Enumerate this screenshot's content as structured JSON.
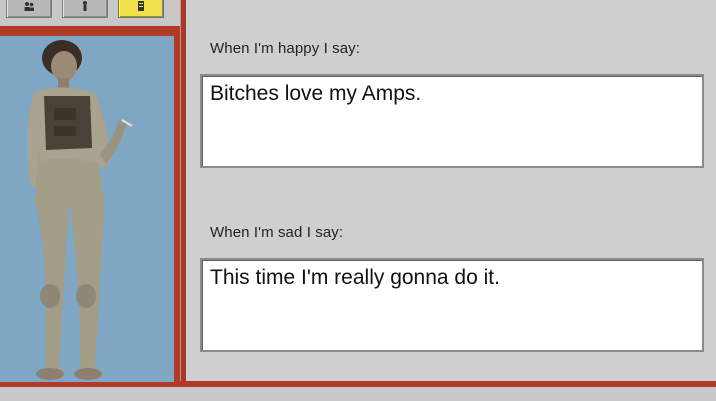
{
  "toolbar": {
    "buttons": [
      {
        "icon": "people-icon"
      },
      {
        "icon": "figure-icon"
      },
      {
        "icon": "document-icon"
      }
    ]
  },
  "portrait": {
    "colors": {
      "background": "#7fa6c3",
      "frame": "#b23a2a"
    }
  },
  "fields": {
    "happy": {
      "label": "When I'm happy I say:",
      "value": "Bitches love my Amps."
    },
    "sad": {
      "label": "When I'm sad I say:",
      "value": "This time I'm really gonna do it."
    }
  }
}
